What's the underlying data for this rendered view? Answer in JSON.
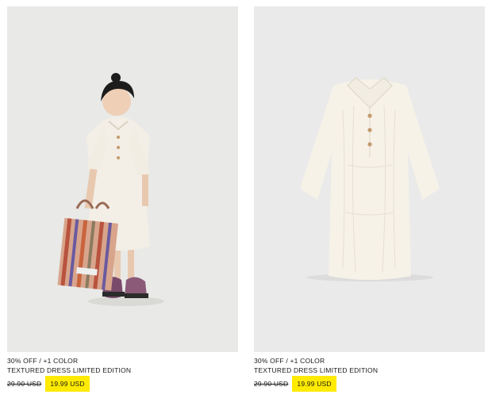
{
  "colors": {
    "sale_highlight": "#ffea00",
    "photo_background": "#e9e9e7"
  },
  "products": [
    {
      "promo": "30% OFF / +1 COLOR",
      "name": "TEXTURED DRESS LIMITED EDITION",
      "old_price": "29.90 USD",
      "sale_price": "19.99 USD",
      "image": "child-model-wearing-white-dress-with-striped-bag"
    },
    {
      "promo": "30% OFF / +1 COLOR",
      "name": "TEXTURED DRESS LIMITED EDITION",
      "old_price": "29.90 USD",
      "sale_price": "19.99 USD",
      "image": "white-textured-dress-flat"
    }
  ]
}
